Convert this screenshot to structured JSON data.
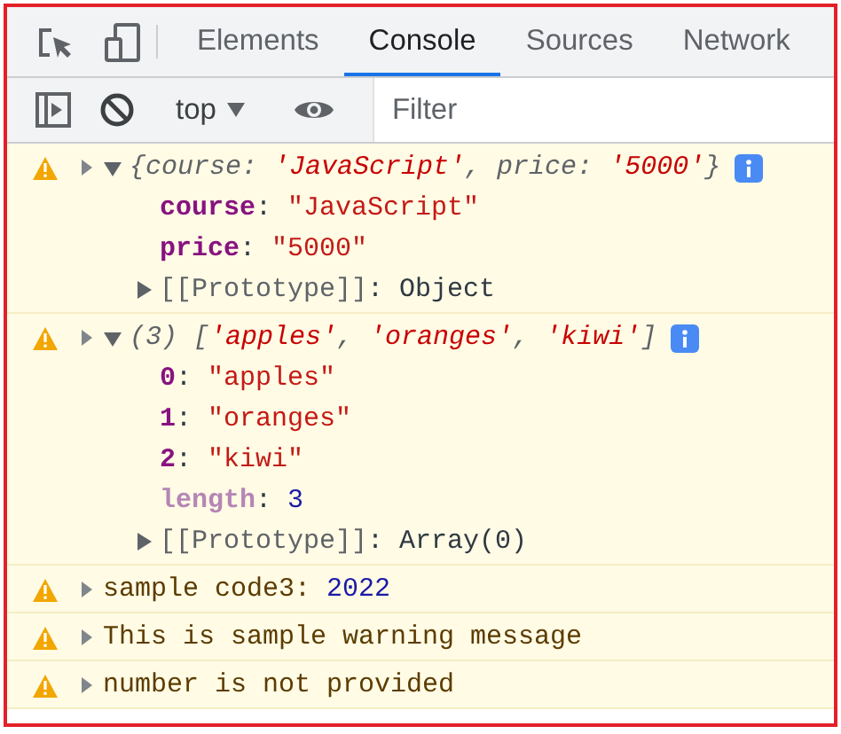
{
  "tabs": [
    {
      "label": "Elements",
      "selected": false
    },
    {
      "label": "Console",
      "selected": true
    },
    {
      "label": "Sources",
      "selected": false
    },
    {
      "label": "Network",
      "selected": false
    }
  ],
  "toolbar": {
    "context": "top",
    "filter": {
      "placeholder": "Filter"
    }
  },
  "messages": [
    {
      "kind": "warning",
      "expanded": true,
      "info_badge": true,
      "summary": [
        {
          "text": "{course: ",
          "kind": "preview"
        },
        {
          "text": "'JavaScript'",
          "kind": "preview_string"
        },
        {
          "text": ", price: ",
          "kind": "preview"
        },
        {
          "text": "'5000'",
          "kind": "preview_string"
        },
        {
          "text": "}",
          "kind": "preview"
        }
      ],
      "properties": [
        {
          "parts": [
            {
              "text": "course",
              "kind": "key"
            },
            {
              "text": ": ",
              "kind": "punct"
            },
            {
              "text": "\"JavaScript\"",
              "kind": "string"
            }
          ]
        },
        {
          "parts": [
            {
              "text": "price",
              "kind": "key"
            },
            {
              "text": ": ",
              "kind": "punct"
            },
            {
              "text": "\"5000\"",
              "kind": "string"
            }
          ]
        }
      ],
      "prototype": {
        "expanded": false,
        "parts": [
          {
            "text": "[[Prototype]]",
            "kind": "internal"
          },
          {
            "text": ": ",
            "kind": "punct"
          },
          {
            "text": "Object",
            "kind": "punct"
          }
        ]
      }
    },
    {
      "kind": "warning",
      "expanded": true,
      "info_badge": true,
      "summary": [
        {
          "text": "(3) [",
          "kind": "preview"
        },
        {
          "text": "'apples'",
          "kind": "preview_string"
        },
        {
          "text": ", ",
          "kind": "preview"
        },
        {
          "text": "'oranges'",
          "kind": "preview_string"
        },
        {
          "text": ", ",
          "kind": "preview"
        },
        {
          "text": "'kiwi'",
          "kind": "preview_string"
        },
        {
          "text": "]",
          "kind": "preview"
        }
      ],
      "properties": [
        {
          "parts": [
            {
              "text": "0",
              "kind": "key"
            },
            {
              "text": ": ",
              "kind": "punct"
            },
            {
              "text": "\"apples\"",
              "kind": "string"
            }
          ]
        },
        {
          "parts": [
            {
              "text": "1",
              "kind": "key"
            },
            {
              "text": ": ",
              "kind": "punct"
            },
            {
              "text": "\"oranges\"",
              "kind": "string"
            }
          ]
        },
        {
          "parts": [
            {
              "text": "2",
              "kind": "key"
            },
            {
              "text": ": ",
              "kind": "punct"
            },
            {
              "text": "\"kiwi\"",
              "kind": "string"
            }
          ]
        },
        {
          "parts": [
            {
              "text": "length",
              "kind": "key_dim"
            },
            {
              "text": ": ",
              "kind": "punct"
            },
            {
              "text": "3",
              "kind": "number"
            }
          ]
        }
      ],
      "prototype": {
        "expanded": false,
        "parts": [
          {
            "text": "[[Prototype]]",
            "kind": "internal"
          },
          {
            "text": ": ",
            "kind": "punct"
          },
          {
            "text": "Array(0)",
            "kind": "punct"
          }
        ]
      }
    },
    {
      "kind": "warning",
      "summary": [
        {
          "text": "sample code3: ",
          "kind": "text"
        },
        {
          "text": "2022",
          "kind": "number"
        }
      ]
    },
    {
      "kind": "warning",
      "summary": [
        {
          "text": "This is sample warning message",
          "kind": "text"
        }
      ]
    },
    {
      "kind": "warning",
      "summary": [
        {
          "text": "number is not provided",
          "kind": "text"
        }
      ]
    }
  ]
}
